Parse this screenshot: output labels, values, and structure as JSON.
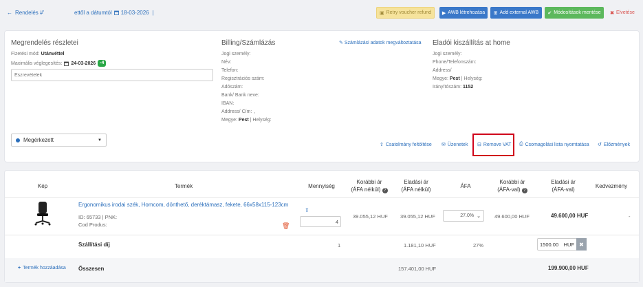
{
  "topbar": {
    "back_label": "Rendelés #'",
    "date_text": "ettől a dátumtól",
    "date_value": "18-03-2026",
    "separator": "|",
    "buttons": {
      "retry": "Retry voucher refund",
      "awb_create": "AWB létrehozása",
      "awb_external": "Add external AWB",
      "save": "Módosítások mentése",
      "cancel": "Elvetése"
    },
    "colors": {
      "retry": "#f6e39c",
      "awb": "#3a78c9",
      "save": "#5cb85c",
      "cancel": "#d9534f"
    }
  },
  "order": {
    "title": "Megrendelés részletei",
    "payment_label": "Fizetési mód:",
    "payment_value": "Utánvéttel",
    "deadline_label": "Maximális véglegesítés:",
    "deadline_value": "24-03-2026",
    "deadline_badge": "-4",
    "notes_placeholder": "Észrevételek",
    "status_value": "Megérkezett"
  },
  "billing": {
    "title": "Billing/Számlázás",
    "edit_link": "Számlázási adatok megváltoztatása",
    "fields": [
      {
        "label": "Jogi személy:",
        "value": ""
      },
      {
        "label": "Név:",
        "value": ""
      },
      {
        "label": "Telefon:",
        "value": ""
      },
      {
        "label": "Regisztrációs szám:",
        "value": ""
      },
      {
        "label": "Adószám:",
        "value": ""
      },
      {
        "label": "Bank/ Bank neve:",
        "value": ""
      },
      {
        "label": "IBAN:",
        "value": ""
      },
      {
        "label": "Address/ Cím:",
        "value": ","
      }
    ],
    "county_label": "Megye:",
    "county_value": "Pest",
    "city_label": "| Helység:"
  },
  "shipping": {
    "title": "Eladói kiszállítás at home",
    "fields": [
      {
        "label": "Jogi személy:",
        "value": ""
      },
      {
        "label": "Phone/Telefonszám:",
        "value": ""
      },
      {
        "label": "Address/",
        "value": ""
      }
    ],
    "county_label": "Megye:",
    "county_value": "Pest",
    "city_label": "| Helység:",
    "zip_label": "Irányítószám:",
    "zip_value": "1152"
  },
  "actions": {
    "upload": "Csatolmány feltöltése",
    "messages": "Üzenetek",
    "remove_vat": "Remove VAT",
    "packing": "Csomagolási lista nyomtatása",
    "history": "Előzmények"
  },
  "table": {
    "headers": {
      "image": "Kép",
      "product": "Termék",
      "qty": "Mennyiség",
      "prev_net_1": "Korábbi ár",
      "prev_net_2": "(ÁFA nélkül)",
      "sale_net_1": "Eladási ár",
      "sale_net_2": "(ÁFA nélkül)",
      "vat": "ÁFA",
      "prev_gross_1": "Korábbi ár",
      "prev_gross_2": "(ÁFA-val)",
      "sale_gross_1": "Eladási ár",
      "sale_gross_2": "(ÁFA-val)",
      "discount": "Kedvezmény"
    },
    "product": {
      "name": "Ergonomikus irodai szék, Homcom, dönthető, deréktámasz, fekete, 66x58x115-123cm",
      "id_line": "ID: 65733 | PNK:",
      "code_line": "Cod Produs:",
      "qty": "4",
      "prev_net": "39.055,12 HUF",
      "sale_net": "39.055,12 HUF",
      "vat": "27.0%",
      "prev_gross": "49.600,00 HUF",
      "sale_gross": "49.600,00 HUF",
      "discount": "-"
    },
    "shipping_row": {
      "label": "Szállítási díj",
      "qty": "1",
      "sale_net": "1.181,10 HUF",
      "vat": "27%",
      "gross_input": "1500.00",
      "currency": "HUF"
    },
    "total_row": {
      "add_product": "Termék hozzáadása",
      "label": "Összesen",
      "sale_net": "157.401,00 HUF",
      "sale_gross": "199.900,00 HUF"
    }
  }
}
